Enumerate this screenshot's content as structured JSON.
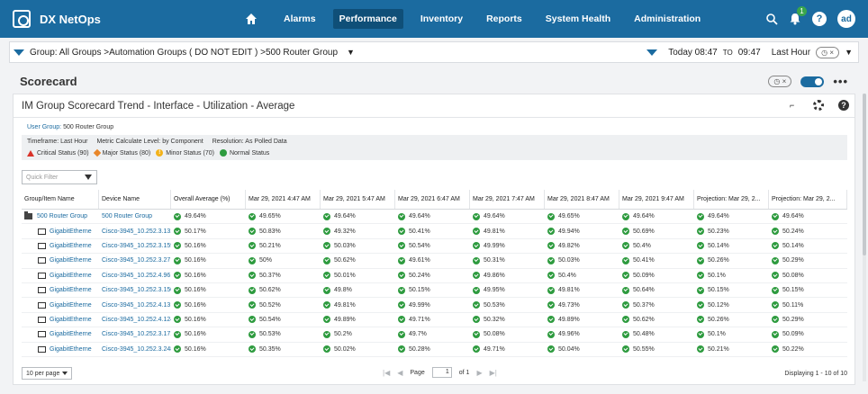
{
  "app": {
    "title": "DX NetOps",
    "avatar": "ad",
    "notifications": "1"
  },
  "nav": [
    {
      "label": "Alarms",
      "active": false
    },
    {
      "label": "Performance",
      "active": true
    },
    {
      "label": "Inventory",
      "active": false
    },
    {
      "label": "Reports",
      "active": false
    },
    {
      "label": "System Health",
      "active": false
    },
    {
      "label": "Administration",
      "active": false
    }
  ],
  "filter": {
    "group_path": "Group: All Groups >Automation Groups ( DO NOT EDIT ) >500 Router Group",
    "time_prefix": "Today 08:47",
    "time_to": "TO",
    "time_end": "09:47",
    "time_range": "Last Hour"
  },
  "scorecard": {
    "title": "Scorecard"
  },
  "panel": {
    "title": "IM Group Scorecard Trend - Interface - Utilization - Average",
    "user_group_label": "User Group:",
    "user_group_value": "500 Router Group",
    "timeframe": "Timeframe: Last Hour",
    "metric_level": "Metric Calculate Level: by Component",
    "resolution": "Resolution: As Polled Data",
    "legend": {
      "critical": "Critical Status (90)",
      "major": "Major Status (80)",
      "minor": "Minor Status (70)",
      "normal": "Normal Status"
    },
    "quick_filter_placeholder": "Quick Filter"
  },
  "table": {
    "headers": [
      "Group/Item Name",
      "Device Name",
      "Overall Average (%)",
      "Mar 29, 2021 4:47 AM",
      "Mar 29, 2021 5:47 AM",
      "Mar 29, 2021 6:47 AM",
      "Mar 29, 2021 7:47 AM",
      "Mar 29, 2021 8:47 AM",
      "Mar 29, 2021 9:47 AM",
      "Projection: Mar 29, 2...",
      "Projection: Mar 29, 2..."
    ],
    "rows": [
      {
        "name": "500 Router Group",
        "device": "500 Router Group",
        "values": [
          "49.64%",
          "49.65%",
          "49.64%",
          "49.64%",
          "49.64%",
          "49.65%",
          "49.64%",
          "49.64%",
          "49.64%"
        ]
      },
      {
        "name": "GigabitEtherne",
        "device": "Cisco-3945_10.252.3.131",
        "values": [
          "50.17%",
          "50.83%",
          "49.32%",
          "50.41%",
          "49.81%",
          "49.94%",
          "50.69%",
          "50.23%",
          "50.24%"
        ]
      },
      {
        "name": "GigabitEtherne",
        "device": "Cisco-3945_10.252.3.159",
        "values": [
          "50.16%",
          "50.21%",
          "50.03%",
          "50.54%",
          "49.99%",
          "49.82%",
          "50.4%",
          "50.14%",
          "50.14%"
        ]
      },
      {
        "name": "GigabitEtherne",
        "device": "Cisco-3945_10.252.3.27",
        "values": [
          "50.16%",
          "50%",
          "50.62%",
          "49.61%",
          "50.31%",
          "50.03%",
          "50.41%",
          "50.26%",
          "50.29%"
        ]
      },
      {
        "name": "GigabitEtherne",
        "device": "Cisco-3945_10.252.4.96",
        "values": [
          "50.16%",
          "50.37%",
          "50.01%",
          "50.24%",
          "49.86%",
          "50.4%",
          "50.09%",
          "50.1%",
          "50.08%"
        ]
      },
      {
        "name": "GigabitEtherne",
        "device": "Cisco-3945_10.252.3.150",
        "values": [
          "50.16%",
          "50.62%",
          "49.8%",
          "50.15%",
          "49.95%",
          "49.81%",
          "50.64%",
          "50.15%",
          "50.15%"
        ]
      },
      {
        "name": "GigabitEtherne",
        "device": "Cisco-3945_10.252.4.13",
        "values": [
          "50.16%",
          "50.52%",
          "49.81%",
          "49.99%",
          "50.53%",
          "49.73%",
          "50.37%",
          "50.12%",
          "50.11%"
        ]
      },
      {
        "name": "GigabitEtherne",
        "device": "Cisco-3945_10.252.4.124",
        "values": [
          "50.16%",
          "50.54%",
          "49.89%",
          "49.71%",
          "50.32%",
          "49.89%",
          "50.62%",
          "50.26%",
          "50.29%"
        ]
      },
      {
        "name": "GigabitEtherne",
        "device": "Cisco-3945_10.252.3.171",
        "values": [
          "50.16%",
          "50.53%",
          "50.2%",
          "49.7%",
          "50.08%",
          "49.96%",
          "50.48%",
          "50.1%",
          "50.09%"
        ]
      },
      {
        "name": "GigabitEtherne",
        "device": "Cisco-3945_10.252.3.248",
        "values": [
          "50.16%",
          "50.35%",
          "50.02%",
          "50.28%",
          "49.71%",
          "50.04%",
          "50.55%",
          "50.21%",
          "50.22%"
        ]
      }
    ]
  },
  "footer": {
    "per_page": "10 per page",
    "page_label": "Page",
    "page_value": "1",
    "page_of": "of 1",
    "displaying": "Displaying 1 - 10 of 10"
  },
  "colors": {
    "brand": "#1b6ba0",
    "normal": "#2e9b3f",
    "critical": "#d9332a",
    "major": "#e8862a",
    "minor": "#f3b21a"
  }
}
